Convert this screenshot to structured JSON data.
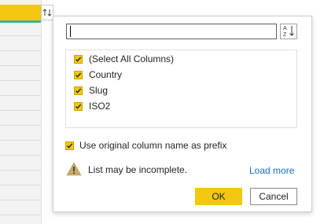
{
  "search": {
    "value": "",
    "placeholder": ""
  },
  "sort_icon": "sort-a-to-z-icon",
  "expand_icon": "expand-columns-icon",
  "columns": [
    {
      "label": "(Select All Columns)",
      "checked": true
    },
    {
      "label": "Country",
      "checked": true
    },
    {
      "label": "Slug",
      "checked": true
    },
    {
      "label": "ISO2",
      "checked": true
    }
  ],
  "prefix_option": {
    "label": "Use original column name as prefix",
    "checked": true
  },
  "warning": {
    "text": "List may be incomplete.",
    "icon": "warning-icon"
  },
  "load_more_label": "Load more",
  "ok_label": "OK",
  "cancel_label": "Cancel",
  "colors": {
    "accent": "#f2c811",
    "link": "#1a6fc2",
    "header_underline": "#3bb3a8",
    "warning_icon": "#c8a96a"
  }
}
